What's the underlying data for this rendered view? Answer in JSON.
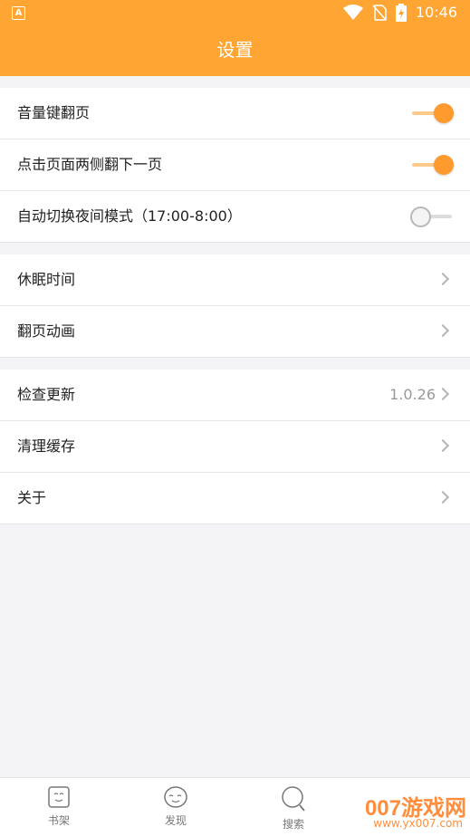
{
  "status_bar": {
    "time": "10:46",
    "icons": [
      "app-a-icon",
      "wifi-icon",
      "no-sim-icon",
      "battery-charging-icon"
    ]
  },
  "header": {
    "title": "设置"
  },
  "groups": [
    {
      "rows": [
        {
          "label": "音量键翻页",
          "control": "switch",
          "on": true
        },
        {
          "label": "点击页面两侧翻下一页",
          "control": "switch",
          "on": true
        },
        {
          "label": "自动切换夜间模式（17:00-8:00）",
          "control": "switch",
          "on": false
        }
      ]
    },
    {
      "rows": [
        {
          "label": "休眠时间",
          "control": "chevron"
        },
        {
          "label": "翻页动画",
          "control": "chevron"
        }
      ]
    },
    {
      "rows": [
        {
          "label": "检查更新",
          "control": "chevron",
          "value": "1.0.26"
        },
        {
          "label": "清理缓存",
          "control": "chevron"
        },
        {
          "label": "关于",
          "control": "chevron"
        }
      ]
    }
  ],
  "tabbar": {
    "tabs": [
      {
        "label": "书架",
        "icon": "bookshelf-icon"
      },
      {
        "label": "发现",
        "icon": "discover-icon"
      },
      {
        "label": "搜索",
        "icon": "search-icon"
      }
    ]
  },
  "watermark": {
    "text": "007游戏网",
    "sub": "www.yx007.com"
  },
  "colors": {
    "accent": "#ffa534",
    "switch_on": "#ff9a2e",
    "background": "#f4f4f6"
  }
}
